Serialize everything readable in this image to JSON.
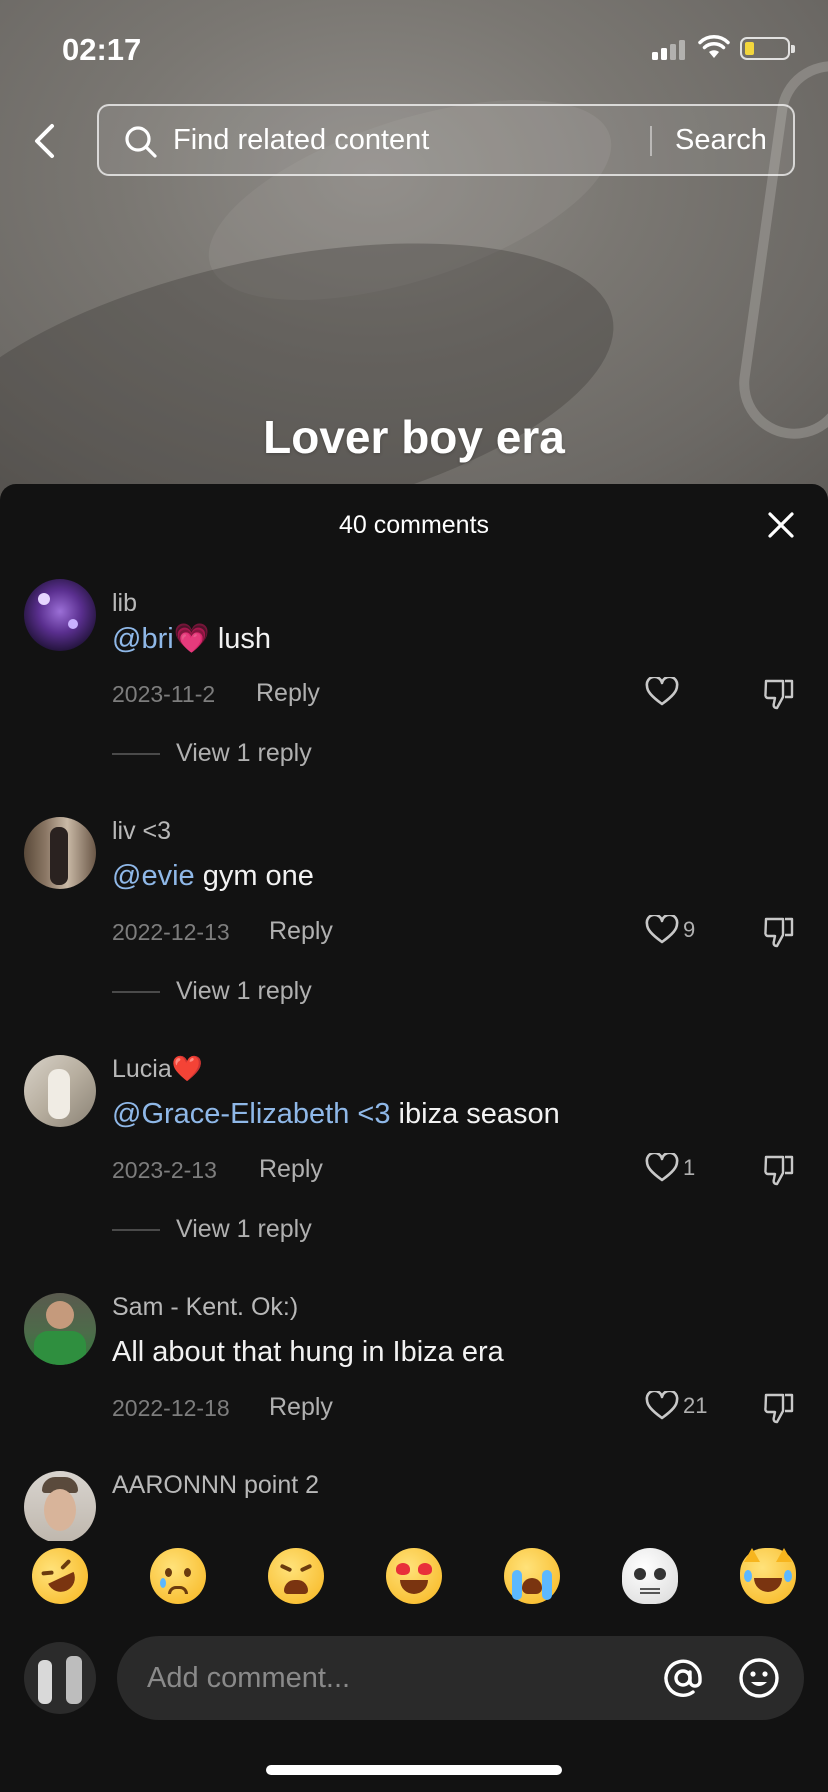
{
  "status_bar": {
    "time": "02:17"
  },
  "search": {
    "placeholder": "Find related content",
    "button_label": "Search"
  },
  "video": {
    "caption": "Lover boy era"
  },
  "comments_sheet": {
    "title": "40 comments",
    "reply_label": "Reply",
    "comments": [
      {
        "user": "lib",
        "mention": "@bri",
        "mention_emoji": "💗",
        "text": " lush",
        "date": "2023-11-2",
        "likes": "",
        "view_replies": "View 1 reply"
      },
      {
        "user": "liv <3",
        "mention": "@evie",
        "mention_emoji": "",
        "text": " gym one",
        "date": "2022-12-13",
        "likes": "9",
        "view_replies": "View 1 reply"
      },
      {
        "user": "Lucia",
        "user_emoji": "❤️",
        "mention": "@Grace-Elizabeth <3",
        "mention_emoji": "",
        "text": " ibiza season",
        "date": "2023-2-13",
        "likes": "1",
        "view_replies": "View 1 reply"
      },
      {
        "user": "Sam - Kent. Ok:)",
        "mention": "",
        "mention_emoji": "",
        "text": "All about that hung in Ibiza era",
        "date": "2022-12-18",
        "likes": "21",
        "view_replies": ""
      },
      {
        "user": "AARONNN point 2",
        "mention": "",
        "mention_emoji": "",
        "text": "",
        "date": "",
        "likes": "",
        "view_replies": ""
      }
    ]
  },
  "quick_emojis": [
    "rolling-laughing",
    "crying",
    "tired",
    "heart-eyes",
    "loudly-crying",
    "skull",
    "cat-joy"
  ],
  "comment_input": {
    "placeholder": "Add comment..."
  },
  "colors": {
    "mention": "#8fb8e8",
    "sheet_bg": "#121212",
    "input_bg": "#2a2a2a"
  }
}
